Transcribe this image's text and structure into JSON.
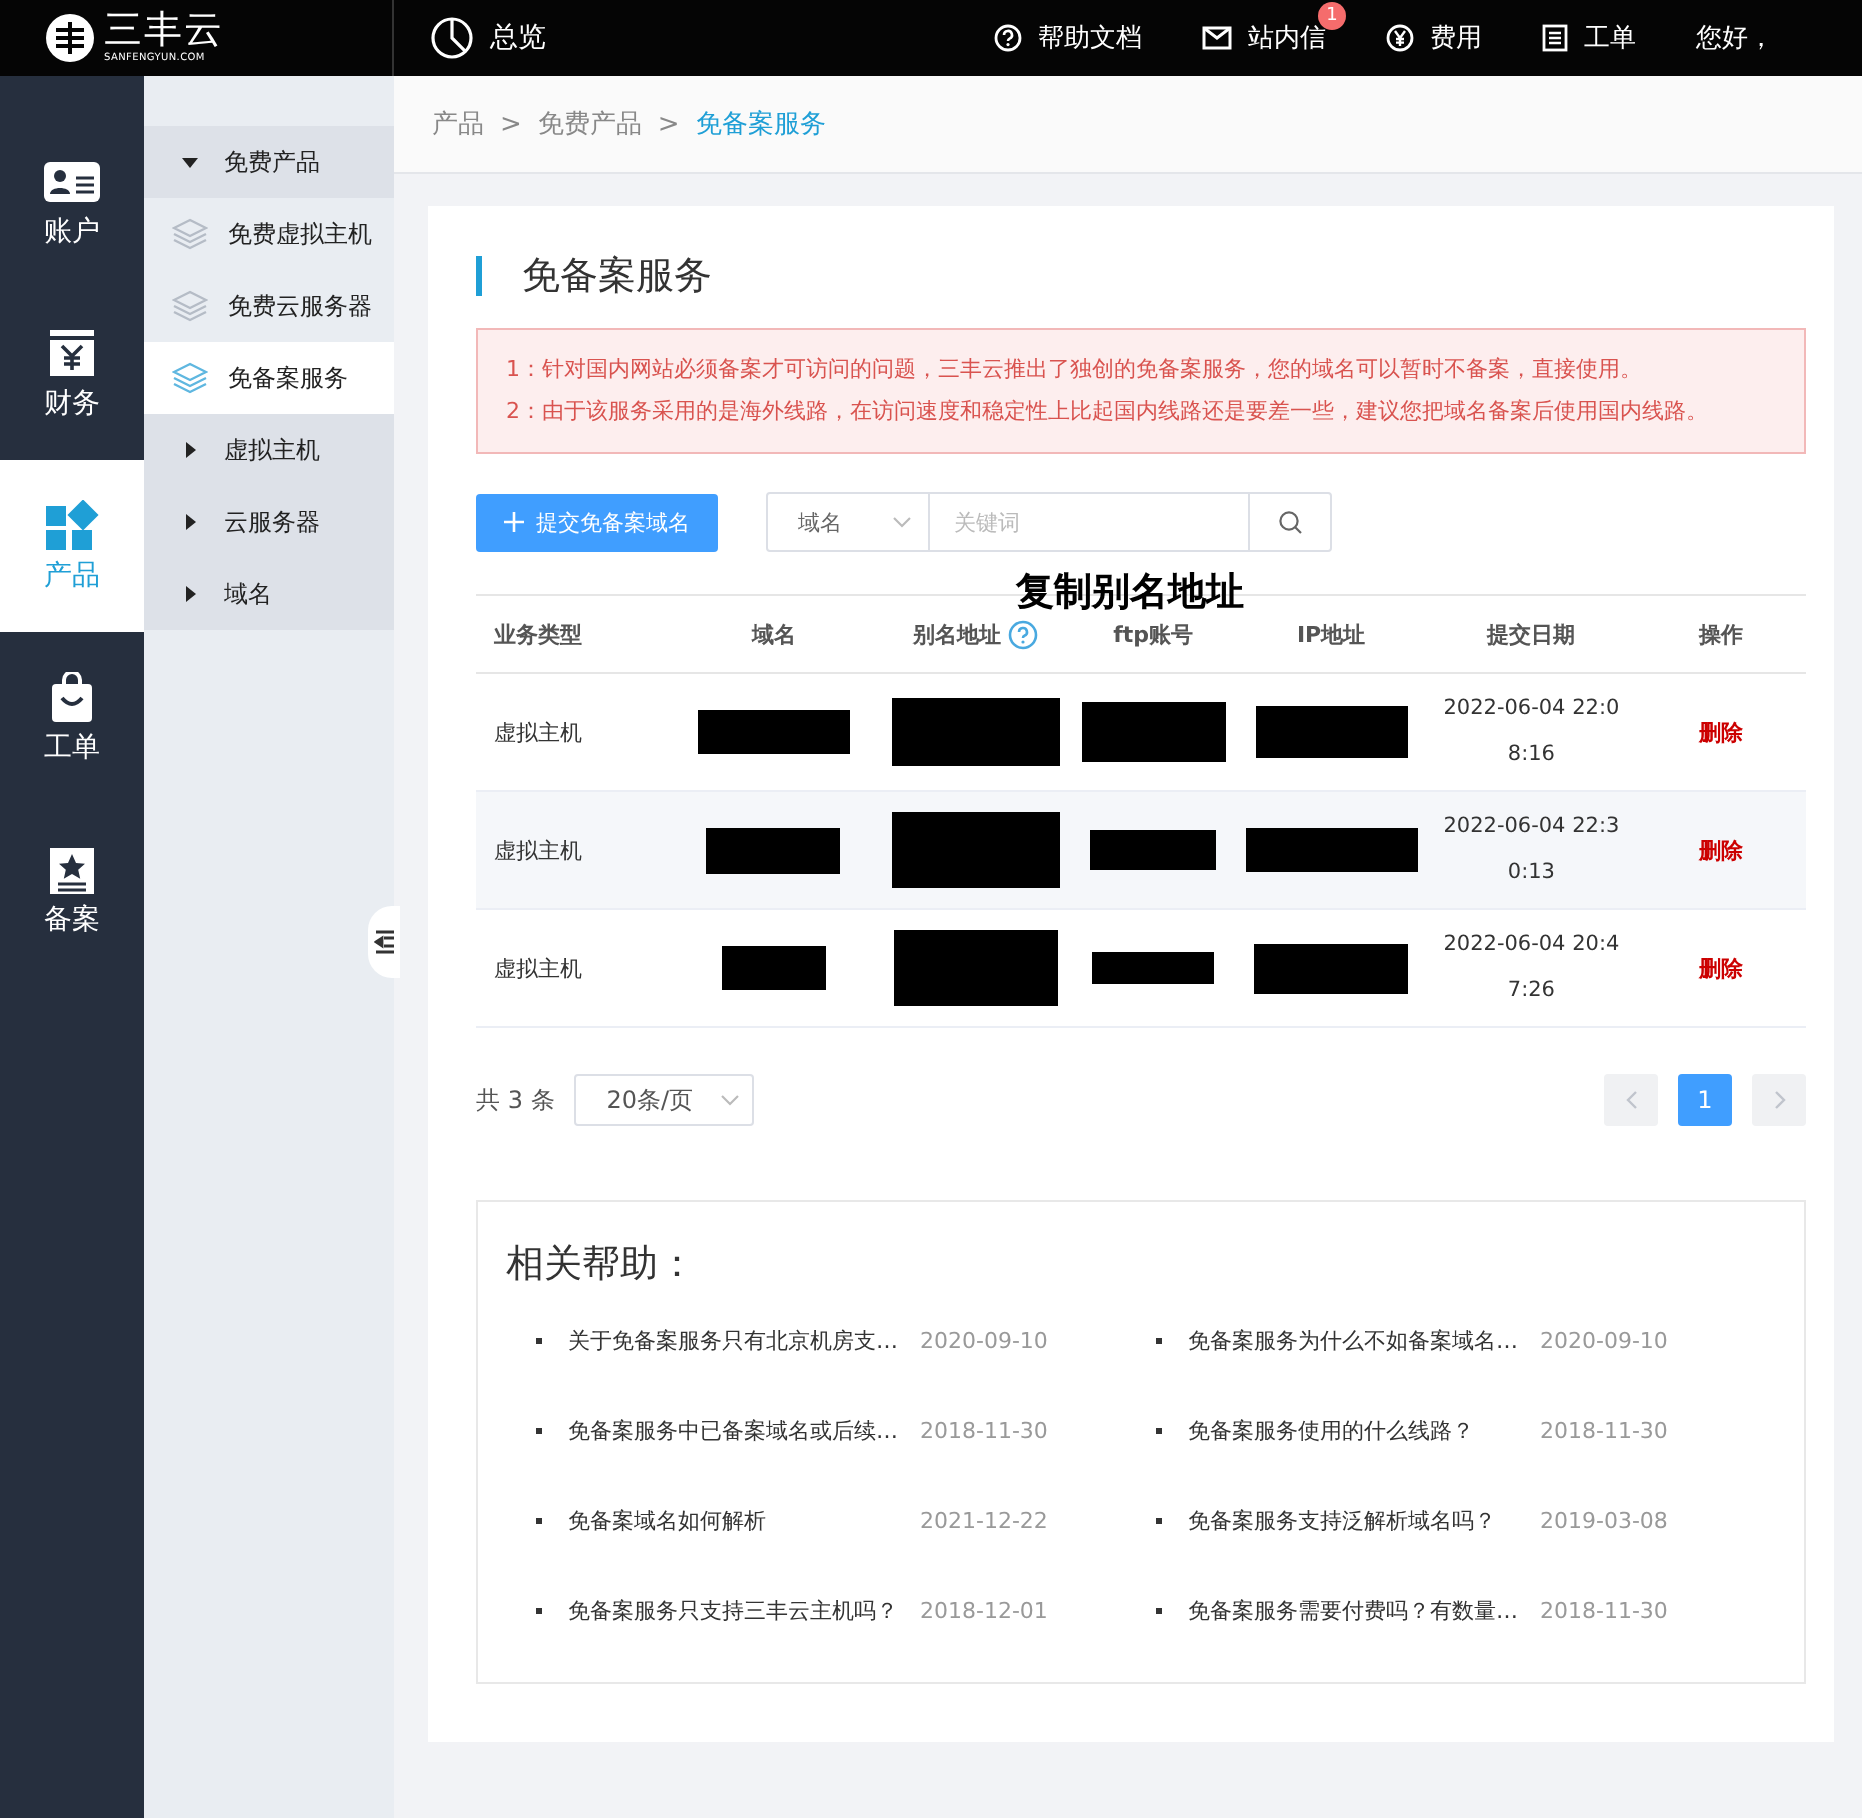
{
  "header": {
    "logo": {
      "name": "三丰云",
      "domain": "SANFENGYUN.COM"
    },
    "overview": "总览",
    "links": [
      {
        "label": "帮助文档",
        "kind": "help"
      },
      {
        "label": "站内信",
        "kind": "mail",
        "badge": "1"
      },
      {
        "label": "费用",
        "kind": "yen"
      },
      {
        "label": "工单",
        "kind": "doc"
      }
    ],
    "greeting": "您好，"
  },
  "rail": {
    "items": [
      {
        "label": "账户",
        "kind": "account",
        "selected": false
      },
      {
        "label": "财务",
        "kind": "finance",
        "selected": false
      },
      {
        "label": "产品",
        "kind": "product",
        "selected": true
      },
      {
        "label": "工单",
        "kind": "bag",
        "selected": false
      },
      {
        "label": "备案",
        "kind": "record",
        "selected": false
      }
    ]
  },
  "submenu": {
    "groups": [
      {
        "label": "免费产品",
        "expanded": true,
        "children": [
          {
            "label": "免费虚拟主机",
            "selected": false
          },
          {
            "label": "免费云服务器",
            "selected": false
          },
          {
            "label": "免备案服务",
            "selected": true
          }
        ]
      },
      {
        "label": "虚拟主机",
        "expanded": false
      },
      {
        "label": "云服务器",
        "expanded": false
      },
      {
        "label": "域名",
        "expanded": false
      }
    ]
  },
  "breadcrumb": [
    {
      "kind": "link",
      "text": "产品"
    },
    {
      "kind": "separator",
      "text": ">"
    },
    {
      "kind": "link",
      "text": "免费产品"
    },
    {
      "kind": "separator",
      "text": ">"
    },
    {
      "kind": "current",
      "text": "免备案服务"
    }
  ],
  "page_title": "免备案服务",
  "notice": [
    "1：针对国内网站必须备案才可访问的问题，三丰云推出了独创的免备案服务，您的域名可以暂时不备案，直接使用。",
    "2：由于该服务采用的是海外线路，在访问速度和稳定性上比起国内线路还是要差一些，建议您把域名备案后使用国内线路。"
  ],
  "toolbar": {
    "submit_button": "提交免备案域名",
    "search_select": "域名",
    "search": {
      "placeholder": "关键词"
    }
  },
  "annotation": "复制别名地址",
  "table": {
    "columns": [
      {
        "label": "业务类型",
        "help": false
      },
      {
        "label": "域名",
        "help": false
      },
      {
        "label": "别名地址",
        "help": true
      },
      {
        "label": "ftp账号",
        "help": false
      },
      {
        "label": "IP地址",
        "help": false
      },
      {
        "label": "提交日期",
        "help": false
      },
      {
        "label": "操作",
        "help": false
      }
    ],
    "rows": [
      {
        "cells": [
          {
            "kind": "text",
            "text": "虚拟主机"
          },
          {
            "kind": "redacted"
          },
          {
            "kind": "redacted"
          },
          {
            "kind": "redacted"
          },
          {
            "kind": "redacted"
          },
          {
            "kind": "text",
            "text": "2022-06-04 22:08:16"
          },
          {
            "kind": "action",
            "text": "删除"
          }
        ]
      },
      {
        "cells": [
          {
            "kind": "text",
            "text": "虚拟主机"
          },
          {
            "kind": "redacted"
          },
          {
            "kind": "redacted"
          },
          {
            "kind": "redacted"
          },
          {
            "kind": "redacted"
          },
          {
            "kind": "text",
            "text": "2022-06-04 22:30:13"
          },
          {
            "kind": "action",
            "text": "删除"
          }
        ]
      },
      {
        "cells": [
          {
            "kind": "text",
            "text": "虚拟主机"
          },
          {
            "kind": "redacted"
          },
          {
            "kind": "redacted"
          },
          {
            "kind": "redacted"
          },
          {
            "kind": "redacted"
          },
          {
            "kind": "text",
            "text": "2022-06-04 20:47:26"
          },
          {
            "kind": "action",
            "text": "删除"
          }
        ]
      }
    ]
  },
  "pagination": {
    "total": "共 3 条",
    "page_size": "20条/页",
    "pages": [
      {
        "label": "1",
        "selected": true
      }
    ]
  },
  "help": {
    "title": "相关帮助：",
    "items": [
      {
        "title": "关于免备案服务只有北京机房支…",
        "date": "2020-09-10"
      },
      {
        "title": "免备案服务为什么不如备案域名…",
        "date": "2020-09-10"
      },
      {
        "title": "免备案服务中已备案域名或后续…",
        "date": "2018-11-30"
      },
      {
        "title": "免备案服务使用的什么线路？",
        "date": "2018-11-30"
      },
      {
        "title": "免备案域名如何解析",
        "date": "2021-12-22"
      },
      {
        "title": "免备案服务支持泛解析域名吗？",
        "date": "2019-03-08"
      },
      {
        "title": "免备案服务只支持三丰云主机吗？",
        "date": "2018-12-01"
      },
      {
        "title": "免备案服务需要付费吗？有数量…",
        "date": "2018-11-30"
      }
    ]
  }
}
